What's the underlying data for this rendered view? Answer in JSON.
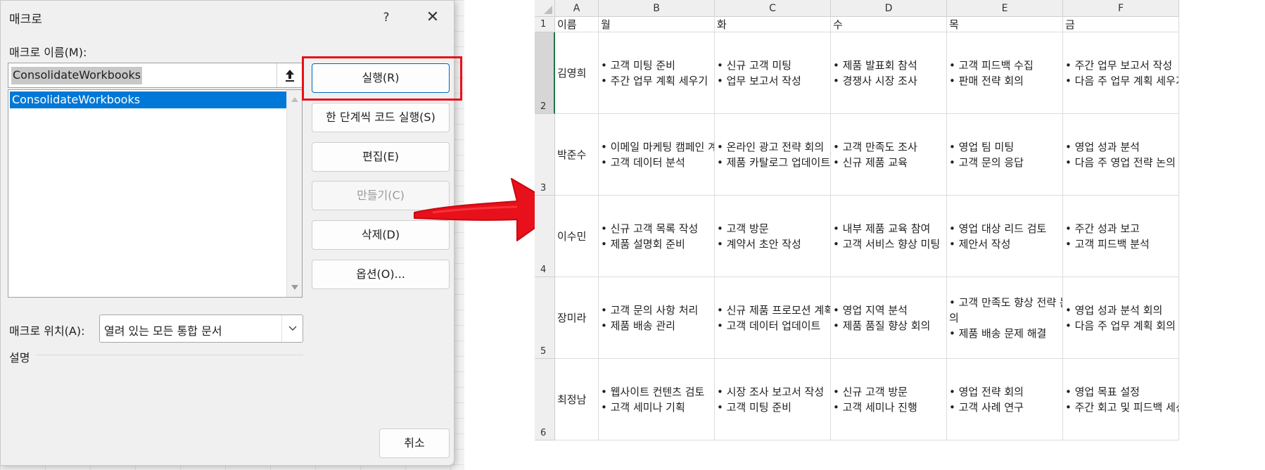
{
  "dialog": {
    "title": "매크로",
    "help_label": "?",
    "close_label": "✕",
    "macro_name_label": "매크로 이름(M):",
    "macro_name_value": "ConsolidateWorkbooks",
    "macros": [
      "ConsolidateWorkbooks"
    ],
    "buttons": {
      "run": "실행(R)",
      "step_into": "한 단계씩 코드 실행(S)",
      "edit": "편집(E)",
      "create": "만들기(C)",
      "delete": "삭제(D)",
      "options": "옵션(O)...",
      "cancel": "취소"
    },
    "macro_location_label": "매크로 위치(A):",
    "macro_location_value": "열려 있는 모든 통합 문서",
    "description_label": "설명"
  },
  "sheet": {
    "columns": [
      "A",
      "B",
      "C",
      "D",
      "E",
      "F"
    ],
    "row_numbers": [
      "1",
      "2",
      "3",
      "4",
      "5",
      "6"
    ],
    "header_row": [
      "이름",
      "월",
      "화",
      "수",
      "목",
      "금"
    ],
    "rows": [
      {
        "name": "김영희",
        "days": [
          [
            "• 고객 미팅 준비",
            "• 주간 업무 계획 세우기"
          ],
          [
            "• 신규 고객 미팅",
            "• 업무 보고서 작성"
          ],
          [
            "• 제품 발표회 참석",
            "• 경쟁사 시장 조사"
          ],
          [
            "• 고객 피드백 수집",
            "• 판매 전략 회의"
          ],
          [
            "• 주간 업무 보고서 작성",
            "• 다음 주 업무 계획 세우기"
          ]
        ]
      },
      {
        "name": "박준수",
        "days": [
          [
            "• 이메일 마케팅 캠페인 계획",
            "• 고객 데이터 분석"
          ],
          [
            "• 온라인 광고 전략 회의",
            "• 제품 카탈로그 업데이트"
          ],
          [
            "• 고객 만족도 조사",
            "• 신규 제품 교육"
          ],
          [
            "• 영업 팀 미팅",
            "• 고객 문의 응답"
          ],
          [
            "• 영업 성과 분석",
            "• 다음 주 영업 전략 논의"
          ]
        ]
      },
      {
        "name": "이수민",
        "days": [
          [
            "• 신규 고객 목록 작성",
            "• 제품 설명회 준비"
          ],
          [
            "• 고객 방문",
            "• 계약서 초안 작성"
          ],
          [
            "• 내부 제품 교육 참여",
            "• 고객 서비스 향상 미팅"
          ],
          [
            "• 영업 대상 리드 검토",
            "• 제안서 작성"
          ],
          [
            "• 주간 성과 보고",
            "• 고객 피드백 분석"
          ]
        ]
      },
      {
        "name": "장미라",
        "days": [
          [
            "• 고객 문의 사항 처리",
            "• 제품 배송 관리"
          ],
          [
            "• 신규 제품 프로모션 계획",
            "• 고객 데이터 업데이트"
          ],
          [
            "• 영업 지역 분석",
            "• 제품 품질 향상 회의"
          ],
          [
            "• 고객 만족도 향상 전략 논",
            "의",
            "• 제품 배송 문제 해결"
          ],
          [
            "• 영업 성과 분석 회의",
            "• 다음 주 업무 계획 회의"
          ]
        ]
      },
      {
        "name": "최정남",
        "days": [
          [
            "• 웹사이트 컨텐츠 검토",
            "• 고객 세미나 기획"
          ],
          [
            "• 시장 조사 보고서 작성",
            "• 고객 미팅 준비"
          ],
          [
            "• 신규 고객 방문",
            "• 고객 세미나 진행"
          ],
          [
            "• 영업 전략 회의",
            "• 고객 사례 연구"
          ],
          [
            "• 영업 목표 설정",
            "• 주간 회고 및 피드백 세션"
          ]
        ]
      }
    ]
  },
  "colors": {
    "highlight": "#e8101a",
    "arrow": "#e8101a",
    "selection": "#0078d7",
    "excel_green": "#217346"
  }
}
